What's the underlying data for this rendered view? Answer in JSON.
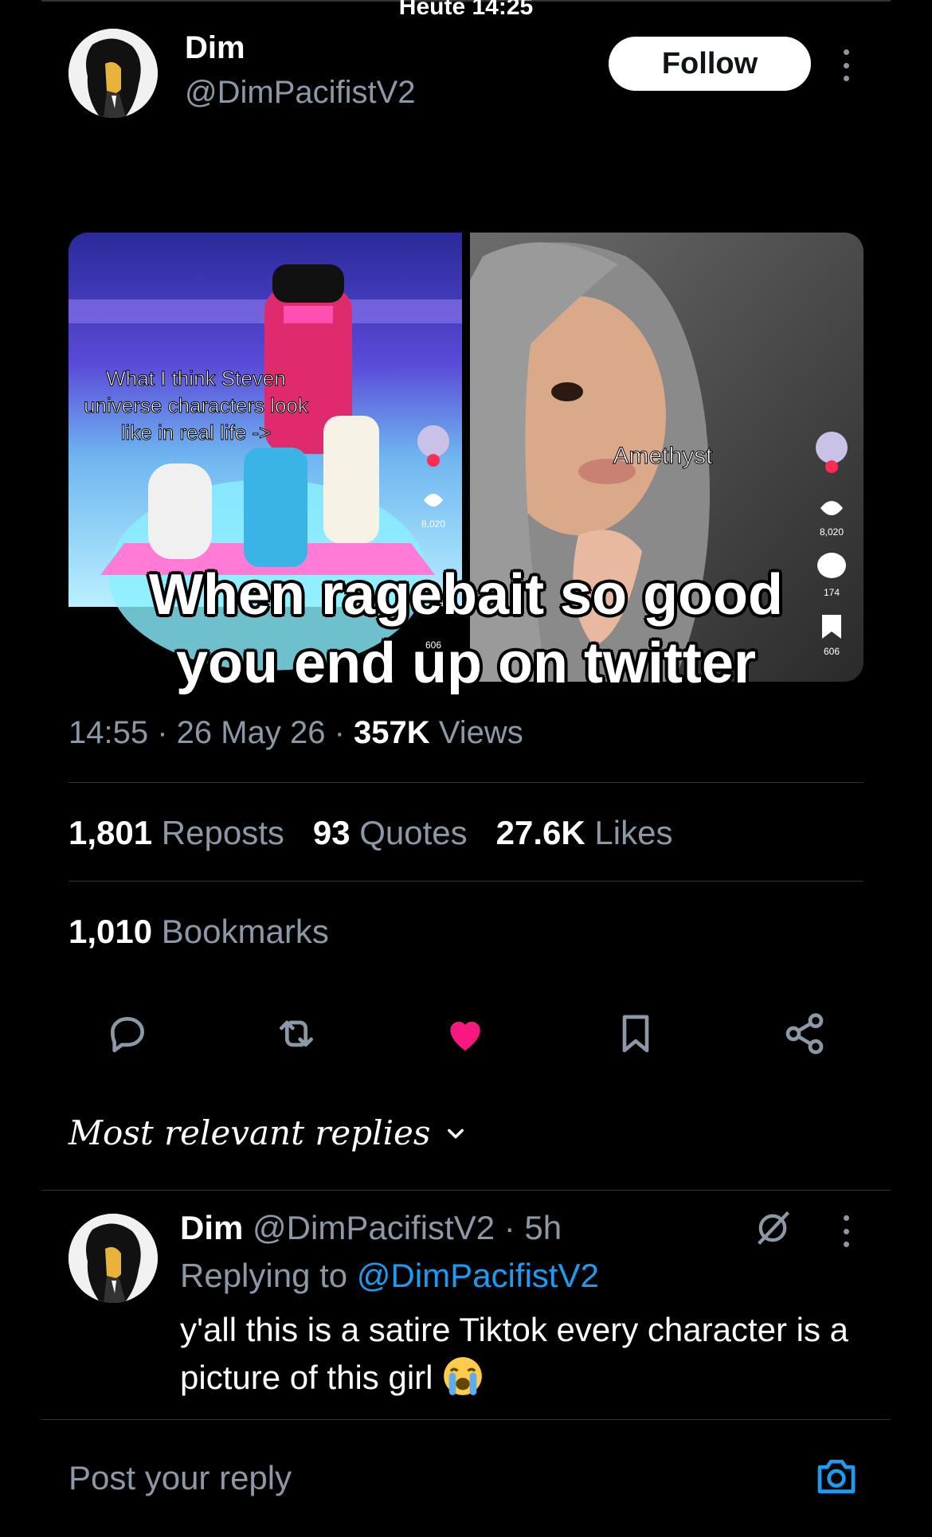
{
  "status_bar": {
    "time": "Heute 14:25"
  },
  "post": {
    "author": {
      "name": "Dim",
      "handle": "@DimPacifistV2"
    },
    "follow_label": "Follow",
    "media": {
      "left_caption": "What I think Steven universe characters look like in real life ->",
      "right_caption": "Amethyst",
      "side_counts": [
        "8,020",
        "174",
        "606"
      ],
      "overlay_caption_line1": "When ragebait so good",
      "overlay_caption_line2": "you end up on twitter"
    },
    "meta": {
      "time": "14:55",
      "date": "26 May 26",
      "views_count": "357K",
      "views_label": "Views"
    },
    "stats": {
      "reposts_count": "1,801",
      "reposts_label": "Reposts",
      "quotes_count": "93",
      "quotes_label": "Quotes",
      "likes_count": "27.6K",
      "likes_label": "Likes",
      "bookmarks_count": "1,010",
      "bookmarks_label": "Bookmarks"
    },
    "actions": [
      "reply-icon",
      "repost-icon",
      "heart-icon",
      "bookmark-icon",
      "share-icon"
    ],
    "liked": true,
    "like_color": "#f91880"
  },
  "replies": {
    "sort_label": "Most relevant replies",
    "items": [
      {
        "name": "Dim",
        "handle": "@DimPacifistV2",
        "age": "· 5h",
        "replying_prefix": "Replying to",
        "replying_to": "@DimPacifistV2",
        "text": "y'all this is a satire Tiktok every character is a picture of this girl",
        "emoji": "loudly-crying-face"
      }
    ]
  },
  "composer": {
    "placeholder": "Post your reply",
    "accent": "#1d9bf0"
  }
}
